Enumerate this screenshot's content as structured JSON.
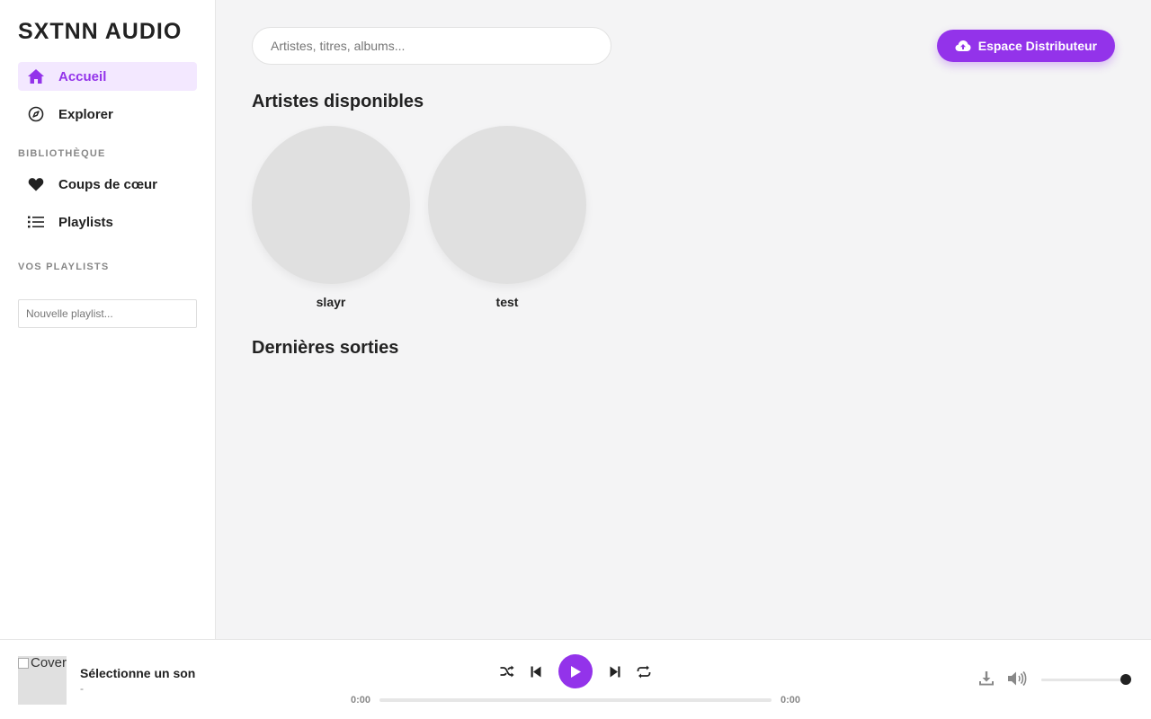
{
  "app": {
    "title": "SXTNN AUDIO",
    "accent": "#9333ea"
  },
  "sidebar": {
    "nav": [
      {
        "label": "Accueil",
        "icon": "home-icon",
        "active": true
      },
      {
        "label": "Explorer",
        "icon": "compass-icon",
        "active": false
      }
    ],
    "library_title": "BIBLIOTHÈQUE",
    "library": [
      {
        "label": "Coups de cœur",
        "icon": "heart-icon"
      },
      {
        "label": "Playlists",
        "icon": "list-icon"
      }
    ],
    "playlists_title": "VOS PLAYLISTS",
    "new_playlist_placeholder": "Nouvelle playlist..."
  },
  "main": {
    "search_placeholder": "Artistes, titres, albums...",
    "distributor_label": "Espace Distributeur",
    "artists_title": "Artistes disponibles",
    "artists": [
      {
        "name": "slayr"
      },
      {
        "name": "test"
      }
    ],
    "releases_title": "Dernières sorties"
  },
  "player": {
    "cover_alt": "Cover",
    "track_title": "Sélectionne un son",
    "track_artist": "-",
    "current_time": "0:00",
    "duration": "0:00",
    "progress": 0,
    "volume": 1.0
  }
}
